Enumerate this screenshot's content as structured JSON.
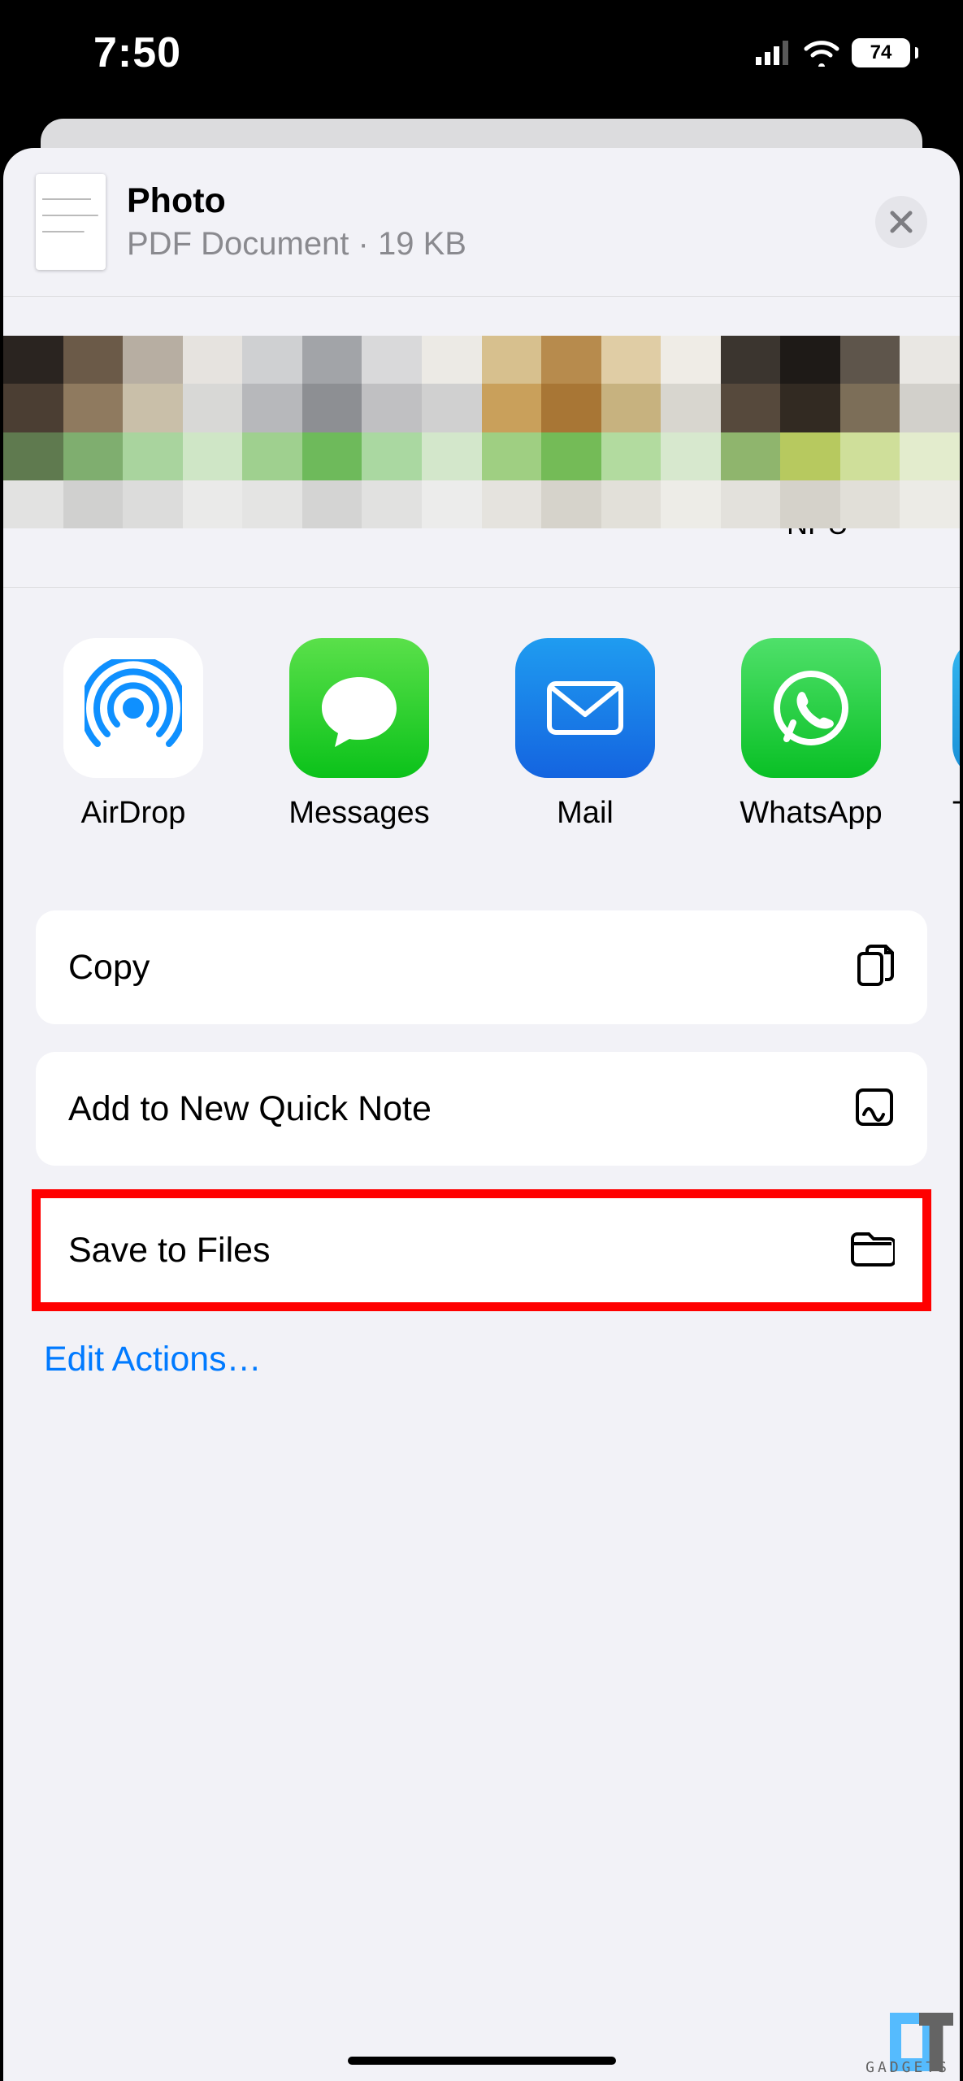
{
  "status": {
    "time": "7:50",
    "battery_pct": "74"
  },
  "document": {
    "title": "Photo",
    "subtitle": "PDF Document · 19 KB"
  },
  "contacts": {
    "items": [
      {
        "name": ""
      },
      {
        "name": ""
      },
      {
        "name": ""
      },
      {
        "name": "NPU"
      }
    ]
  },
  "apps": {
    "items": [
      {
        "name": "AirDrop",
        "icon": "airdrop-icon"
      },
      {
        "name": "Messages",
        "icon": "messages-icon"
      },
      {
        "name": "Mail",
        "icon": "mail-icon"
      },
      {
        "name": "WhatsApp",
        "icon": "whatsapp-icon"
      },
      {
        "name": "Te",
        "icon": "telegram-icon"
      }
    ]
  },
  "actions": {
    "copy": "Copy",
    "quicknote": "Add to New Quick Note",
    "save_files": "Save to Files",
    "edit": "Edit Actions…"
  },
  "watermark": "GADGETS"
}
